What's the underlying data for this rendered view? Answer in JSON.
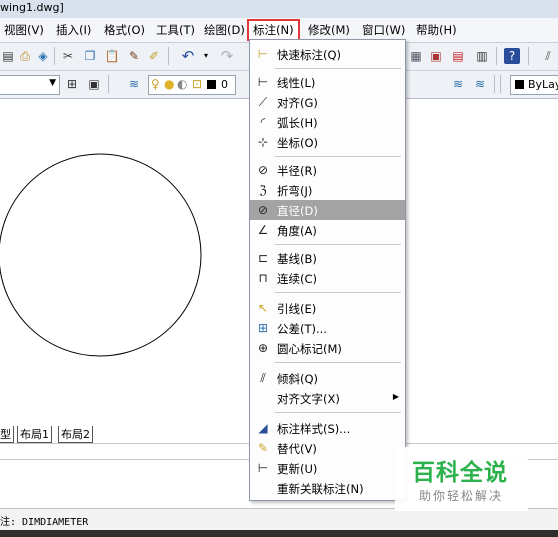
{
  "window": {
    "title": "wing1.dwg]"
  },
  "menubar": {
    "items": [
      "视图(V)",
      "插入(I)",
      "格式(O)",
      "工具(T)",
      "绘图(D)",
      "标注(N)",
      "修改(M)",
      "窗口(W)",
      "帮助(H)"
    ]
  },
  "toolbar": {
    "layer_value": "0",
    "linetype_value": "ByLay"
  },
  "layout_tabs": [
    "型",
    "布局1",
    "布局2"
  ],
  "dimension_menu": {
    "items": [
      {
        "label": "快速标注(Q)",
        "icon": "quick-dimension-icon"
      },
      {
        "label": "线性(L)",
        "icon": "linear-dimension-icon"
      },
      {
        "label": "对齐(G)",
        "icon": "aligned-dimension-icon"
      },
      {
        "label": "弧长(H)",
        "icon": "arc-length-icon"
      },
      {
        "label": "坐标(O)",
        "icon": "ordinate-icon"
      },
      {
        "label": "半径(R)",
        "icon": "radius-icon"
      },
      {
        "label": "折弯(J)",
        "icon": "jogged-icon"
      },
      {
        "label": "直径(D)",
        "icon": "diameter-icon",
        "highlighted": true
      },
      {
        "label": "角度(A)",
        "icon": "angular-icon"
      },
      {
        "label": "基线(B)",
        "icon": "baseline-icon"
      },
      {
        "label": "连续(C)",
        "icon": "continue-icon"
      },
      {
        "label": "引线(E)",
        "icon": "leader-icon"
      },
      {
        "label": "公差(T)...",
        "icon": "tolerance-icon"
      },
      {
        "label": "圆心标记(M)",
        "icon": "center-mark-icon"
      },
      {
        "label": "倾斜(Q)",
        "icon": "oblique-icon"
      },
      {
        "label": "对齐文字(X)",
        "icon": "",
        "submenu": true
      },
      {
        "label": "标注样式(S)...",
        "icon": "dimension-style-icon"
      },
      {
        "label": "替代(V)",
        "icon": "override-icon"
      },
      {
        "label": "更新(U)",
        "icon": "update-icon"
      },
      {
        "label": "重新关联标注(N)",
        "icon": ""
      }
    ]
  },
  "command_line": {
    "status": "注:  DIMDIAMETER"
  },
  "watermark": {
    "title": "百科全说",
    "subtitle": "助你轻松解决"
  },
  "colors": {
    "highlight": "#a3a3a3",
    "menu_outline": "#e23a3a",
    "annotation_arrow": "#e23a3a",
    "watermark_green": "#2bb24c"
  }
}
